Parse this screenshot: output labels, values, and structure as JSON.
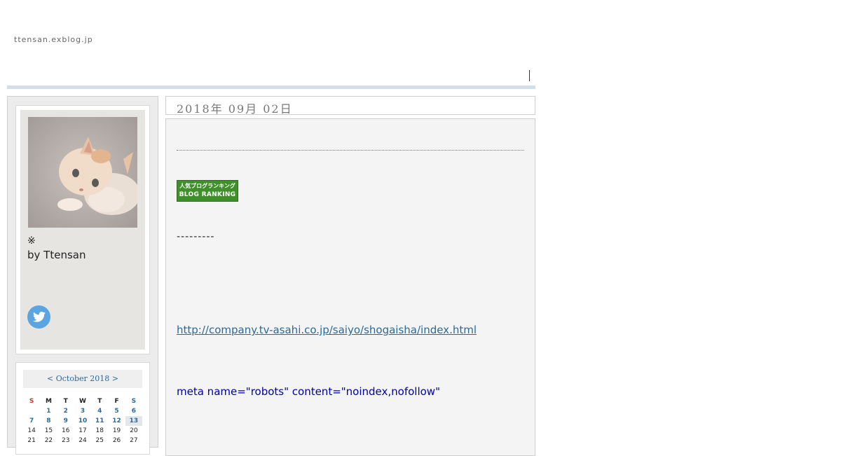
{
  "header": {
    "site_url": "ttensan.exblog.jp"
  },
  "sidebar": {
    "profile": {
      "mark": "※",
      "by_line": "by Ttensan",
      "twitter_icon": "twitter-icon"
    },
    "calendar": {
      "title": "< October 2018 >",
      "day_names": [
        "S",
        "M",
        "T",
        "W",
        "T",
        "F",
        "S"
      ],
      "weeks": [
        [
          "",
          "1",
          "2",
          "3",
          "4",
          "5",
          "6"
        ],
        [
          "7",
          "8",
          "9",
          "10",
          "11",
          "12",
          "13"
        ],
        [
          "14",
          "15",
          "16",
          "17",
          "18",
          "19",
          "20"
        ],
        [
          "21",
          "22",
          "23",
          "24",
          "25",
          "26",
          "27"
        ]
      ]
    }
  },
  "post": {
    "date": "2018年 09月 02日",
    "banner_line1": "人気ブログランキング",
    "banner_line2": "BLOG RANKING",
    "dashes": "---------",
    "link": "http://company.tv-asahi.co.jp/saiyo/shogaisha/index.html",
    "meta_text": "meta name=\"robots\" content=\"noindex,nofollow\""
  },
  "colors": {
    "link": "#2a6a9a",
    "meta_text": "#0000aa",
    "twitter": "#5aa4e2",
    "header_bar": "#d3dfe6"
  }
}
